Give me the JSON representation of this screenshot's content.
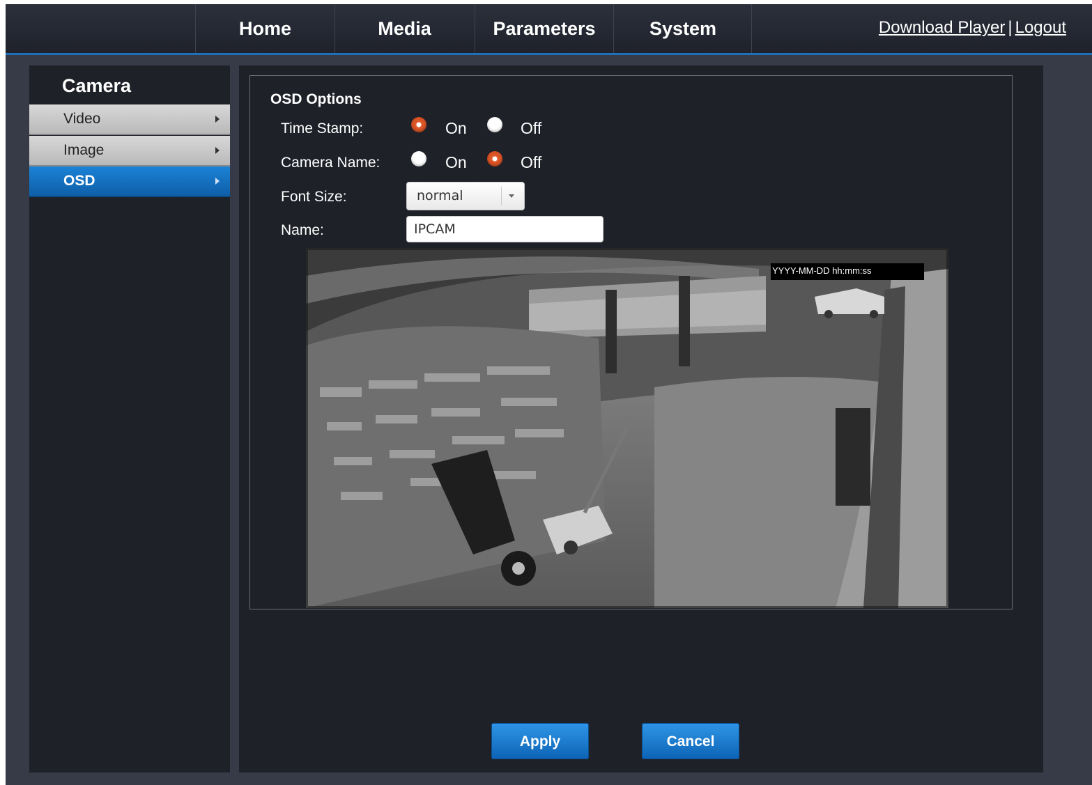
{
  "nav": {
    "items": [
      "Home",
      "Media",
      "Parameters",
      "System"
    ],
    "download_player": "Download Player",
    "separator": "|",
    "logout": "Logout"
  },
  "sidebar": {
    "title": "Camera",
    "items": [
      {
        "label": "Video",
        "active": false
      },
      {
        "label": "Image",
        "active": false
      },
      {
        "label": "OSD",
        "active": true
      }
    ]
  },
  "osd": {
    "title": "OSD Options",
    "time_stamp": {
      "label": "Time Stamp:",
      "on": "On",
      "off": "Off",
      "selected": "On"
    },
    "camera_name": {
      "label": "Camera Name:",
      "on": "On",
      "off": "Off",
      "selected": "Off"
    },
    "font_size": {
      "label": "Font Size:",
      "value": "normal"
    },
    "name": {
      "label": "Name:",
      "value": "IPCAM"
    },
    "preview_timestamp": "YYYY-MM-DD hh:mm:ss"
  },
  "buttons": {
    "apply": "Apply",
    "cancel": "Cancel"
  },
  "colors": {
    "accent_blue": "#1e6fb8",
    "radio_selected": "#e05a2a",
    "panel_bg": "#1f2129",
    "page_bg": "#373b47"
  }
}
